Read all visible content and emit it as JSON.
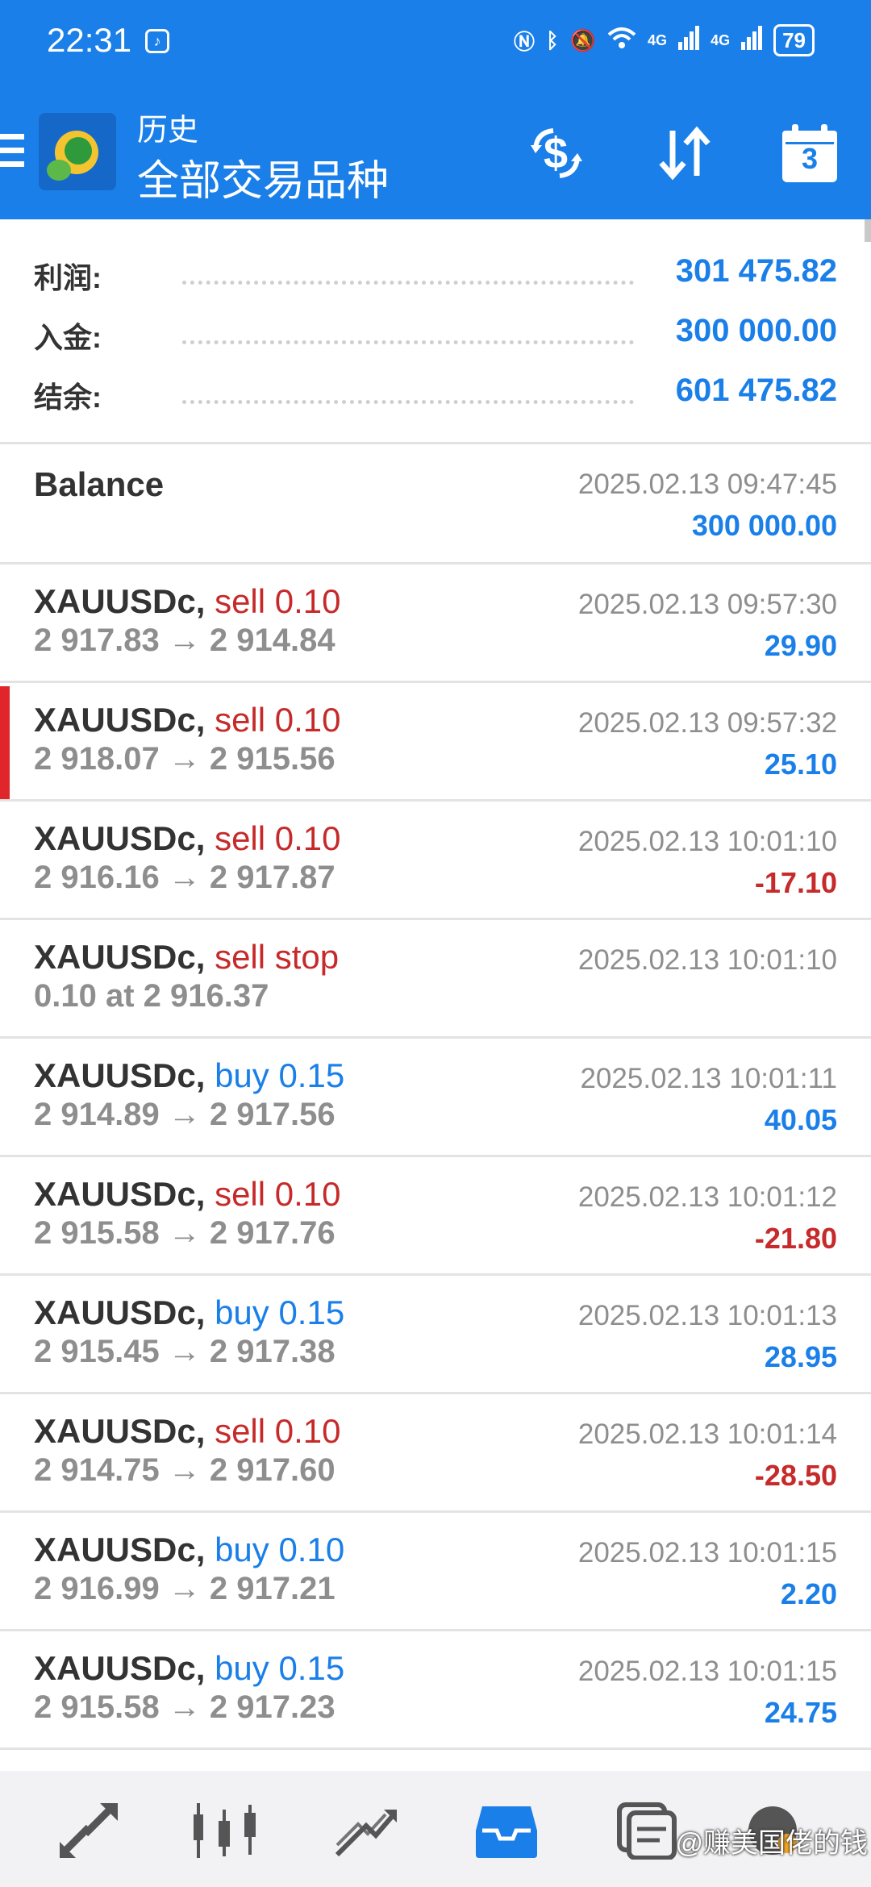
{
  "status_bar": {
    "time": "22:31",
    "network_1": "4G",
    "network_2": "4G",
    "battery": "79"
  },
  "header": {
    "title": "历史",
    "subtitle": "全部交易品种",
    "calendar_day": "3",
    "background_color": "#1a7fe8"
  },
  "summary": {
    "profit_label": "利润:",
    "profit_value": "301 475.82",
    "deposit_label": "入金:",
    "deposit_value": "300 000.00",
    "balance_label": "结余:",
    "balance_value": "601 475.82"
  },
  "balance_entry": {
    "label": "Balance",
    "time": "2025.02.13 09:47:45",
    "amount": "300 000.00"
  },
  "deals": [
    {
      "symbol": "XAUUSDc,",
      "side": "sell 0.10",
      "direction": "sell",
      "prices": "2 917.83 → 2 914.84",
      "time": "2025.02.13 09:57:30",
      "profit": "29.90",
      "profit_sign": "pos"
    },
    {
      "symbol": "XAUUSDc,",
      "side": "sell 0.10",
      "direction": "sell",
      "prices": "2 918.07 → 2 915.56",
      "time": "2025.02.13 09:57:32",
      "profit": "25.10",
      "profit_sign": "pos",
      "selected": true
    },
    {
      "symbol": "XAUUSDc,",
      "side": "sell 0.10",
      "direction": "sell",
      "prices": "2 916.16 → 2 917.87",
      "time": "2025.02.13 10:01:10",
      "profit": "-17.10",
      "profit_sign": "neg"
    },
    {
      "symbol": "XAUUSDc,",
      "side": "sell stop",
      "direction": "sell",
      "prices": "0.10 at 2 916.37",
      "time": "2025.02.13 10:01:10",
      "profit": "",
      "profit_sign": "pos"
    },
    {
      "symbol": "XAUUSDc,",
      "side": "buy 0.15",
      "direction": "buy",
      "prices": "2 914.89 → 2 917.56",
      "time": "2025.02.13 10:01:11",
      "profit": "40.05",
      "profit_sign": "pos"
    },
    {
      "symbol": "XAUUSDc,",
      "side": "sell 0.10",
      "direction": "sell",
      "prices": "2 915.58 → 2 917.76",
      "time": "2025.02.13 10:01:12",
      "profit": "-21.80",
      "profit_sign": "neg"
    },
    {
      "symbol": "XAUUSDc,",
      "side": "buy 0.15",
      "direction": "buy",
      "prices": "2 915.45 → 2 917.38",
      "time": "2025.02.13 10:01:13",
      "profit": "28.95",
      "profit_sign": "pos"
    },
    {
      "symbol": "XAUUSDc,",
      "side": "sell 0.10",
      "direction": "sell",
      "prices": "2 914.75 → 2 917.60",
      "time": "2025.02.13 10:01:14",
      "profit": "-28.50",
      "profit_sign": "neg"
    },
    {
      "symbol": "XAUUSDc,",
      "side": "buy 0.10",
      "direction": "buy",
      "prices": "2 916.99 → 2 917.21",
      "time": "2025.02.13 10:01:15",
      "profit": "2.20",
      "profit_sign": "pos"
    },
    {
      "symbol": "XAUUSDc,",
      "side": "buy 0.15",
      "direction": "buy",
      "prices": "2 915.58 → 2 917.23",
      "time": "2025.02.13 10:01:15",
      "profit": "24.75",
      "profit_sign": "pos"
    }
  ],
  "bottom_nav": {
    "items": [
      {
        "icon": "quotes-icon",
        "active": false
      },
      {
        "icon": "chart-icon",
        "active": false
      },
      {
        "icon": "trade-icon",
        "active": false
      },
      {
        "icon": "history-icon",
        "active": true
      },
      {
        "icon": "messages-icon",
        "active": false
      },
      {
        "icon": "settings-icon",
        "active": false
      }
    ],
    "watermark": "@赚美国佬的钱"
  },
  "colors": {
    "accent_blue": "#1a7fe8",
    "sell_red": "#c62a2a",
    "selection_bar": "#e0262a"
  }
}
